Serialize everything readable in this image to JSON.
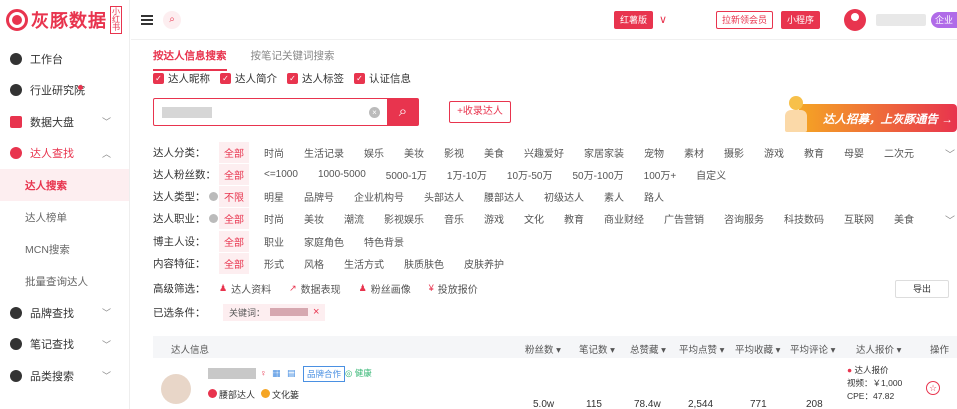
{
  "logo": {
    "brand": "灰豚数据",
    "tag": "小红书"
  },
  "sidebar": {
    "items": [
      {
        "label": "工作台"
      },
      {
        "label": "行业研究院"
      },
      {
        "label": "数据大盘",
        "chevron": "chevron-down"
      },
      {
        "label": "达人查找",
        "chevron": "chevron-up"
      },
      {
        "label": "品牌查找",
        "chevron": "chevron-down"
      },
      {
        "label": "笔记查找",
        "chevron": "chevron-down"
      },
      {
        "label": "品类搜索",
        "chevron": "chevron-down"
      }
    ],
    "subitems": [
      "达人搜索",
      "达人榜单",
      "MCN搜索",
      "批量查询达人"
    ]
  },
  "topbar": {
    "version": "红薯版",
    "invite": "拉新领会员",
    "mini": "小程序",
    "corp": "企业"
  },
  "tabs": [
    "按达人信息搜索",
    "按笔记关键词搜索"
  ],
  "checks": [
    "达人昵称",
    "达人简介",
    "达人标签",
    "认证信息"
  ],
  "search": {
    "collect": "+收录达人",
    "search_icon": "magnifier",
    "clear_icon": "close"
  },
  "banner": {
    "text": "达人招募，上灰豚通告 →"
  },
  "filters": [
    {
      "label": "达人分类：",
      "opts": [
        "全部",
        "时尚",
        "生活记录",
        "娱乐",
        "美妆",
        "影视",
        "美食",
        "兴趣爱好",
        "家居家装",
        "宠物",
        "素材",
        "摄影",
        "游戏",
        "教育",
        "母婴",
        "二次元"
      ]
    },
    {
      "label": "达人粉丝数：",
      "opts": [
        "全部",
        "<=1000",
        "1000-5000",
        "5000-1万",
        "1万-10万",
        "10万-50万",
        "50万-100万",
        "100万+",
        "自定义"
      ]
    },
    {
      "label": "达人类型：",
      "opts": [
        "不限",
        "明星",
        "品牌号",
        "企业机构号",
        "头部达人",
        "腰部达人",
        "初级达人",
        "素人",
        "路人"
      ]
    },
    {
      "label": "达人职业：",
      "opts": [
        "全部",
        "时尚",
        "美妆",
        "潮流",
        "影视娱乐",
        "音乐",
        "游戏",
        "文化",
        "教育",
        "商业财经",
        "广告营销",
        "咨询服务",
        "科技数码",
        "互联网",
        "美食"
      ]
    },
    {
      "label": "博主人设：",
      "opts": [
        "全部",
        "职业",
        "家庭角色",
        "特色背景"
      ]
    },
    {
      "label": "内容特征：",
      "opts": [
        "全部",
        "形式",
        "风格",
        "生活方式",
        "肤质肤色",
        "皮肤养护"
      ]
    }
  ],
  "advanced": {
    "label": "高级筛选：",
    "links": [
      "达人资料",
      "数据表现",
      "粉丝画像",
      "投放报价"
    ],
    "export": "导出"
  },
  "selected": {
    "label": "已选条件：",
    "keyword_prefix": "关键词："
  },
  "table": {
    "headers": [
      "达人信息",
      "粉丝数 ▾",
      "笔记数 ▾",
      "总赞藏 ▾",
      "平均点赞 ▾",
      "平均收藏 ▾",
      "平均评论 ▾",
      "达人报价 ▾",
      "操作"
    ],
    "row": {
      "tag": "品牌合作",
      "health": "◎ 健康",
      "level1": "腰部达人",
      "level2": "文化篓",
      "values": [
        "5.0w",
        "115",
        "78.4w",
        "2,544",
        "771",
        "208"
      ],
      "price_title": "达人报价",
      "price_video": "视频：￥1,000",
      "cpe": "CPE：47.82"
    }
  }
}
